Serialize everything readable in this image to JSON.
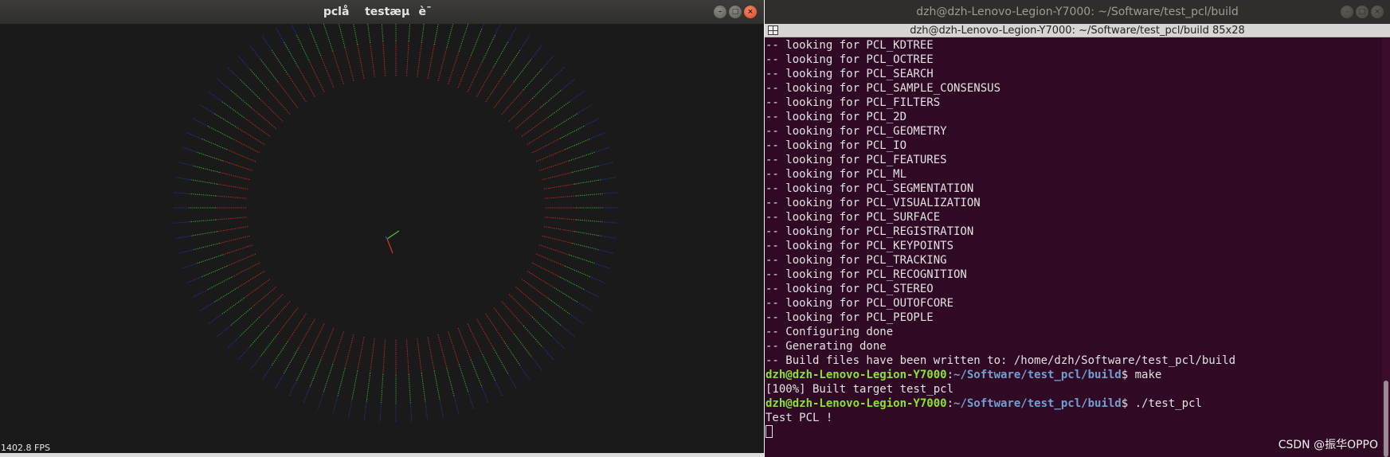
{
  "viewer": {
    "title": "pclåtestæµè¯",
    "fps": "1402.8 FPS",
    "under_strip_text": "…                      ·   …  …   …     …",
    "controls": [
      "–",
      "□",
      "×"
    ]
  },
  "terminal": {
    "title": "dzh@dzh-Lenovo-Legion-Y7000: ~/Software/test_pcl/build",
    "tab_title": "dzh@dzh-Lenovo-Legion-Y7000: ~/Software/test_pcl/build 85x28",
    "controls": [
      "–",
      "□",
      "×"
    ],
    "lines": [
      "-- looking for PCL_KDTREE",
      "-- looking for PCL_OCTREE",
      "-- looking for PCL_SEARCH",
      "-- looking for PCL_SAMPLE_CONSENSUS",
      "-- looking for PCL_FILTERS",
      "-- looking for PCL_2D",
      "-- looking for PCL_GEOMETRY",
      "-- looking for PCL_IO",
      "-- looking for PCL_FEATURES",
      "-- looking for PCL_ML",
      "-- looking for PCL_SEGMENTATION",
      "-- looking for PCL_VISUALIZATION",
      "-- looking for PCL_SURFACE",
      "-- looking for PCL_REGISTRATION",
      "-- looking for PCL_KEYPOINTS",
      "-- looking for PCL_TRACKING",
      "-- looking for PCL_RECOGNITION",
      "-- looking for PCL_STEREO",
      "-- looking for PCL_OUTOFCORE",
      "-- looking for PCL_PEOPLE",
      "-- Configuring done",
      "-- Generating done",
      "-- Build files have been written to: /home/dzh/Software/test_pcl/build"
    ],
    "prompt_user": "dzh@dzh-Lenovo-Legion-Y7000",
    "prompt_sep": ":",
    "prompt_path": "~/Software/test_pcl/build",
    "prompt_dollar": "$ ",
    "cmd1": "make",
    "out1": "[100%] Built target test_pcl",
    "cmd2": "./test_pcl",
    "out2": "Test PCL !"
  },
  "watermark": "CSDN @振华OPPO",
  "colors": {
    "terminal_bg": "#300a24",
    "prompt_user": "#8ae234",
    "prompt_path": "#729fcf",
    "viewer_bg": "#1a1a1a",
    "ray_red": "#e0302a",
    "ray_green": "#3ec83a",
    "ray_blue": "#2a3fd8"
  }
}
